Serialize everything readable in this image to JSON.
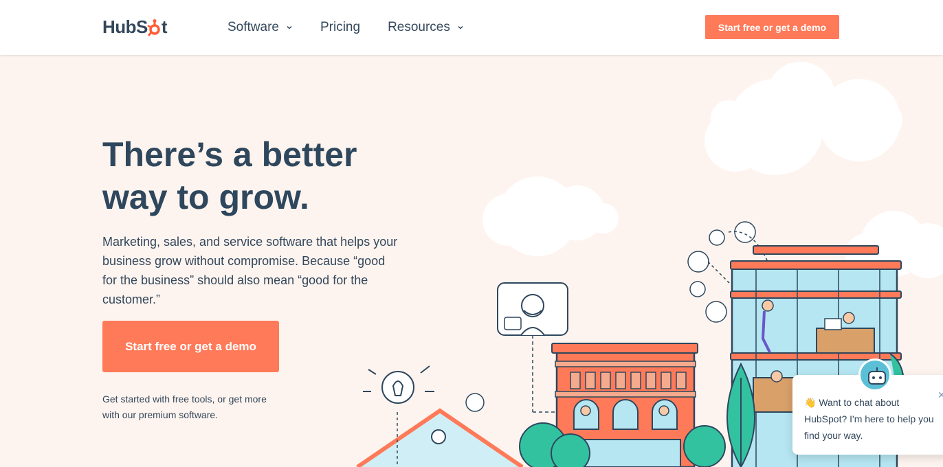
{
  "header": {
    "logo_text_a": "HubS",
    "logo_text_b": "t",
    "nav": [
      {
        "label": "Software",
        "has_dropdown": true
      },
      {
        "label": "Pricing",
        "has_dropdown": false
      },
      {
        "label": "Resources",
        "has_dropdown": true
      }
    ],
    "cta_label": "Start free or get a demo"
  },
  "hero": {
    "title_line1": "There’s a better",
    "title_line2": "way to grow.",
    "subtitle": "Marketing, sales, and service software that helps your business grow without compromise. Because “good for the business” should also mean “good for the customer.”",
    "cta_label": "Start free or get a demo",
    "note": "Get started with free tools, or get more with our premium software."
  },
  "chat": {
    "emoji": "👋",
    "message": "Want to chat about HubSpot? I'm here to help you find your way."
  },
  "colors": {
    "accent": "#ff7a59",
    "heading": "#2e475d",
    "text": "#33475b",
    "background": "#fef4ef",
    "teal": "#33c2a0",
    "sky": "#b5e6f2"
  },
  "icons": {
    "logo": "hubspot-sprocket-icon",
    "dropdown": "chevron-down-icon",
    "close": "close-icon"
  }
}
